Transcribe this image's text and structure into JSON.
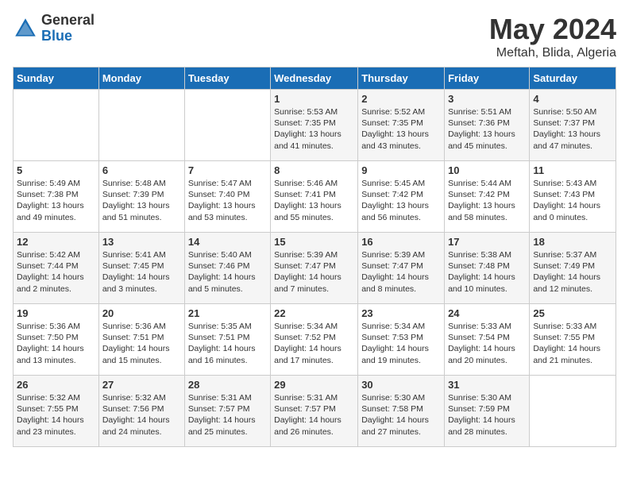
{
  "logo": {
    "general": "General",
    "blue": "Blue"
  },
  "title": {
    "month_year": "May 2024",
    "location": "Meftah, Blida, Algeria"
  },
  "weekdays": [
    "Sunday",
    "Monday",
    "Tuesday",
    "Wednesday",
    "Thursday",
    "Friday",
    "Saturday"
  ],
  "weeks": [
    [
      {
        "day": "",
        "sunrise": "",
        "sunset": "",
        "daylight": ""
      },
      {
        "day": "",
        "sunrise": "",
        "sunset": "",
        "daylight": ""
      },
      {
        "day": "",
        "sunrise": "",
        "sunset": "",
        "daylight": ""
      },
      {
        "day": "1",
        "sunrise": "Sunrise: 5:53 AM",
        "sunset": "Sunset: 7:35 PM",
        "daylight": "Daylight: 13 hours and 41 minutes."
      },
      {
        "day": "2",
        "sunrise": "Sunrise: 5:52 AM",
        "sunset": "Sunset: 7:35 PM",
        "daylight": "Daylight: 13 hours and 43 minutes."
      },
      {
        "day": "3",
        "sunrise": "Sunrise: 5:51 AM",
        "sunset": "Sunset: 7:36 PM",
        "daylight": "Daylight: 13 hours and 45 minutes."
      },
      {
        "day": "4",
        "sunrise": "Sunrise: 5:50 AM",
        "sunset": "Sunset: 7:37 PM",
        "daylight": "Daylight: 13 hours and 47 minutes."
      }
    ],
    [
      {
        "day": "5",
        "sunrise": "Sunrise: 5:49 AM",
        "sunset": "Sunset: 7:38 PM",
        "daylight": "Daylight: 13 hours and 49 minutes."
      },
      {
        "day": "6",
        "sunrise": "Sunrise: 5:48 AM",
        "sunset": "Sunset: 7:39 PM",
        "daylight": "Daylight: 13 hours and 51 minutes."
      },
      {
        "day": "7",
        "sunrise": "Sunrise: 5:47 AM",
        "sunset": "Sunset: 7:40 PM",
        "daylight": "Daylight: 13 hours and 53 minutes."
      },
      {
        "day": "8",
        "sunrise": "Sunrise: 5:46 AM",
        "sunset": "Sunset: 7:41 PM",
        "daylight": "Daylight: 13 hours and 55 minutes."
      },
      {
        "day": "9",
        "sunrise": "Sunrise: 5:45 AM",
        "sunset": "Sunset: 7:42 PM",
        "daylight": "Daylight: 13 hours and 56 minutes."
      },
      {
        "day": "10",
        "sunrise": "Sunrise: 5:44 AM",
        "sunset": "Sunset: 7:42 PM",
        "daylight": "Daylight: 13 hours and 58 minutes."
      },
      {
        "day": "11",
        "sunrise": "Sunrise: 5:43 AM",
        "sunset": "Sunset: 7:43 PM",
        "daylight": "Daylight: 14 hours and 0 minutes."
      }
    ],
    [
      {
        "day": "12",
        "sunrise": "Sunrise: 5:42 AM",
        "sunset": "Sunset: 7:44 PM",
        "daylight": "Daylight: 14 hours and 2 minutes."
      },
      {
        "day": "13",
        "sunrise": "Sunrise: 5:41 AM",
        "sunset": "Sunset: 7:45 PM",
        "daylight": "Daylight: 14 hours and 3 minutes."
      },
      {
        "day": "14",
        "sunrise": "Sunrise: 5:40 AM",
        "sunset": "Sunset: 7:46 PM",
        "daylight": "Daylight: 14 hours and 5 minutes."
      },
      {
        "day": "15",
        "sunrise": "Sunrise: 5:39 AM",
        "sunset": "Sunset: 7:47 PM",
        "daylight": "Daylight: 14 hours and 7 minutes."
      },
      {
        "day": "16",
        "sunrise": "Sunrise: 5:39 AM",
        "sunset": "Sunset: 7:47 PM",
        "daylight": "Daylight: 14 hours and 8 minutes."
      },
      {
        "day": "17",
        "sunrise": "Sunrise: 5:38 AM",
        "sunset": "Sunset: 7:48 PM",
        "daylight": "Daylight: 14 hours and 10 minutes."
      },
      {
        "day": "18",
        "sunrise": "Sunrise: 5:37 AM",
        "sunset": "Sunset: 7:49 PM",
        "daylight": "Daylight: 14 hours and 12 minutes."
      }
    ],
    [
      {
        "day": "19",
        "sunrise": "Sunrise: 5:36 AM",
        "sunset": "Sunset: 7:50 PM",
        "daylight": "Daylight: 14 hours and 13 minutes."
      },
      {
        "day": "20",
        "sunrise": "Sunrise: 5:36 AM",
        "sunset": "Sunset: 7:51 PM",
        "daylight": "Daylight: 14 hours and 15 minutes."
      },
      {
        "day": "21",
        "sunrise": "Sunrise: 5:35 AM",
        "sunset": "Sunset: 7:51 PM",
        "daylight": "Daylight: 14 hours and 16 minutes."
      },
      {
        "day": "22",
        "sunrise": "Sunrise: 5:34 AM",
        "sunset": "Sunset: 7:52 PM",
        "daylight": "Daylight: 14 hours and 17 minutes."
      },
      {
        "day": "23",
        "sunrise": "Sunrise: 5:34 AM",
        "sunset": "Sunset: 7:53 PM",
        "daylight": "Daylight: 14 hours and 19 minutes."
      },
      {
        "day": "24",
        "sunrise": "Sunrise: 5:33 AM",
        "sunset": "Sunset: 7:54 PM",
        "daylight": "Daylight: 14 hours and 20 minutes."
      },
      {
        "day": "25",
        "sunrise": "Sunrise: 5:33 AM",
        "sunset": "Sunset: 7:55 PM",
        "daylight": "Daylight: 14 hours and 21 minutes."
      }
    ],
    [
      {
        "day": "26",
        "sunrise": "Sunrise: 5:32 AM",
        "sunset": "Sunset: 7:55 PM",
        "daylight": "Daylight: 14 hours and 23 minutes."
      },
      {
        "day": "27",
        "sunrise": "Sunrise: 5:32 AM",
        "sunset": "Sunset: 7:56 PM",
        "daylight": "Daylight: 14 hours and 24 minutes."
      },
      {
        "day": "28",
        "sunrise": "Sunrise: 5:31 AM",
        "sunset": "Sunset: 7:57 PM",
        "daylight": "Daylight: 14 hours and 25 minutes."
      },
      {
        "day": "29",
        "sunrise": "Sunrise: 5:31 AM",
        "sunset": "Sunset: 7:57 PM",
        "daylight": "Daylight: 14 hours and 26 minutes."
      },
      {
        "day": "30",
        "sunrise": "Sunrise: 5:30 AM",
        "sunset": "Sunset: 7:58 PM",
        "daylight": "Daylight: 14 hours and 27 minutes."
      },
      {
        "day": "31",
        "sunrise": "Sunrise: 5:30 AM",
        "sunset": "Sunset: 7:59 PM",
        "daylight": "Daylight: 14 hours and 28 minutes."
      },
      {
        "day": "",
        "sunrise": "",
        "sunset": "",
        "daylight": ""
      }
    ]
  ]
}
